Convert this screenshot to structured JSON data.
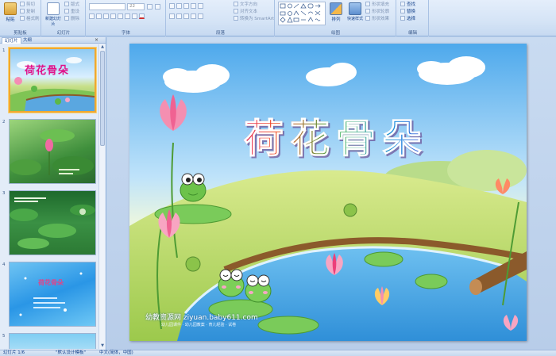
{
  "ribbon": {
    "clipboard": {
      "label": "剪贴板",
      "paste": "粘贴",
      "cut": "剪切",
      "copy": "复制",
      "format_painter": "格式刷"
    },
    "slides": {
      "label": "幻灯片",
      "new_slide": "新建幻灯片",
      "layout": "版式",
      "reset": "重设",
      "delete": "删除"
    },
    "font": {
      "label": "字体",
      "font_size": "22"
    },
    "paragraph": {
      "label": "段落",
      "text_direction": "文字方向",
      "align_text": "对齐文本",
      "convert_smartart": "转换为 SmartArt"
    },
    "drawing": {
      "label": "绘图",
      "arrange": "排列",
      "quick_styles": "快速样式",
      "shape_fill": "形状填充",
      "shape_outline": "形状轮廓",
      "shape_effects": "形状效果"
    },
    "editing": {
      "label": "编辑",
      "find": "查找",
      "replace": "替换",
      "select": "选择"
    }
  },
  "pane": {
    "tab_slides": "幻灯片",
    "tab_outline": "大纲",
    "close": "×",
    "thumbnails": [
      {
        "num": "1",
        "title": "荷花骨朵",
        "selected": true
      },
      {
        "num": "2",
        "title": ""
      },
      {
        "num": "3",
        "title": ""
      },
      {
        "num": "4",
        "title": "荷花骨朵"
      },
      {
        "num": "5",
        "title": ""
      }
    ]
  },
  "slide": {
    "title": "荷花骨朵",
    "watermark": "幼教资源网 ziyuan.baby611.com",
    "watermark_sub": "幼儿园课件 · 幼儿园教案 · 育儿经验 · 试卷"
  },
  "status": {
    "slide_info": "幻灯片 1/6",
    "theme": "\"默认设计模板\"",
    "language": "中文(简体，中国)"
  },
  "colors": {
    "title_gradient": [
      "#e0128a",
      "#f04a1e",
      "#f5a80c",
      "#3ab04a",
      "#1e8ee0",
      "#8a3ed8"
    ],
    "selection": "#f0a830",
    "ribbon_text": "#15428b"
  }
}
